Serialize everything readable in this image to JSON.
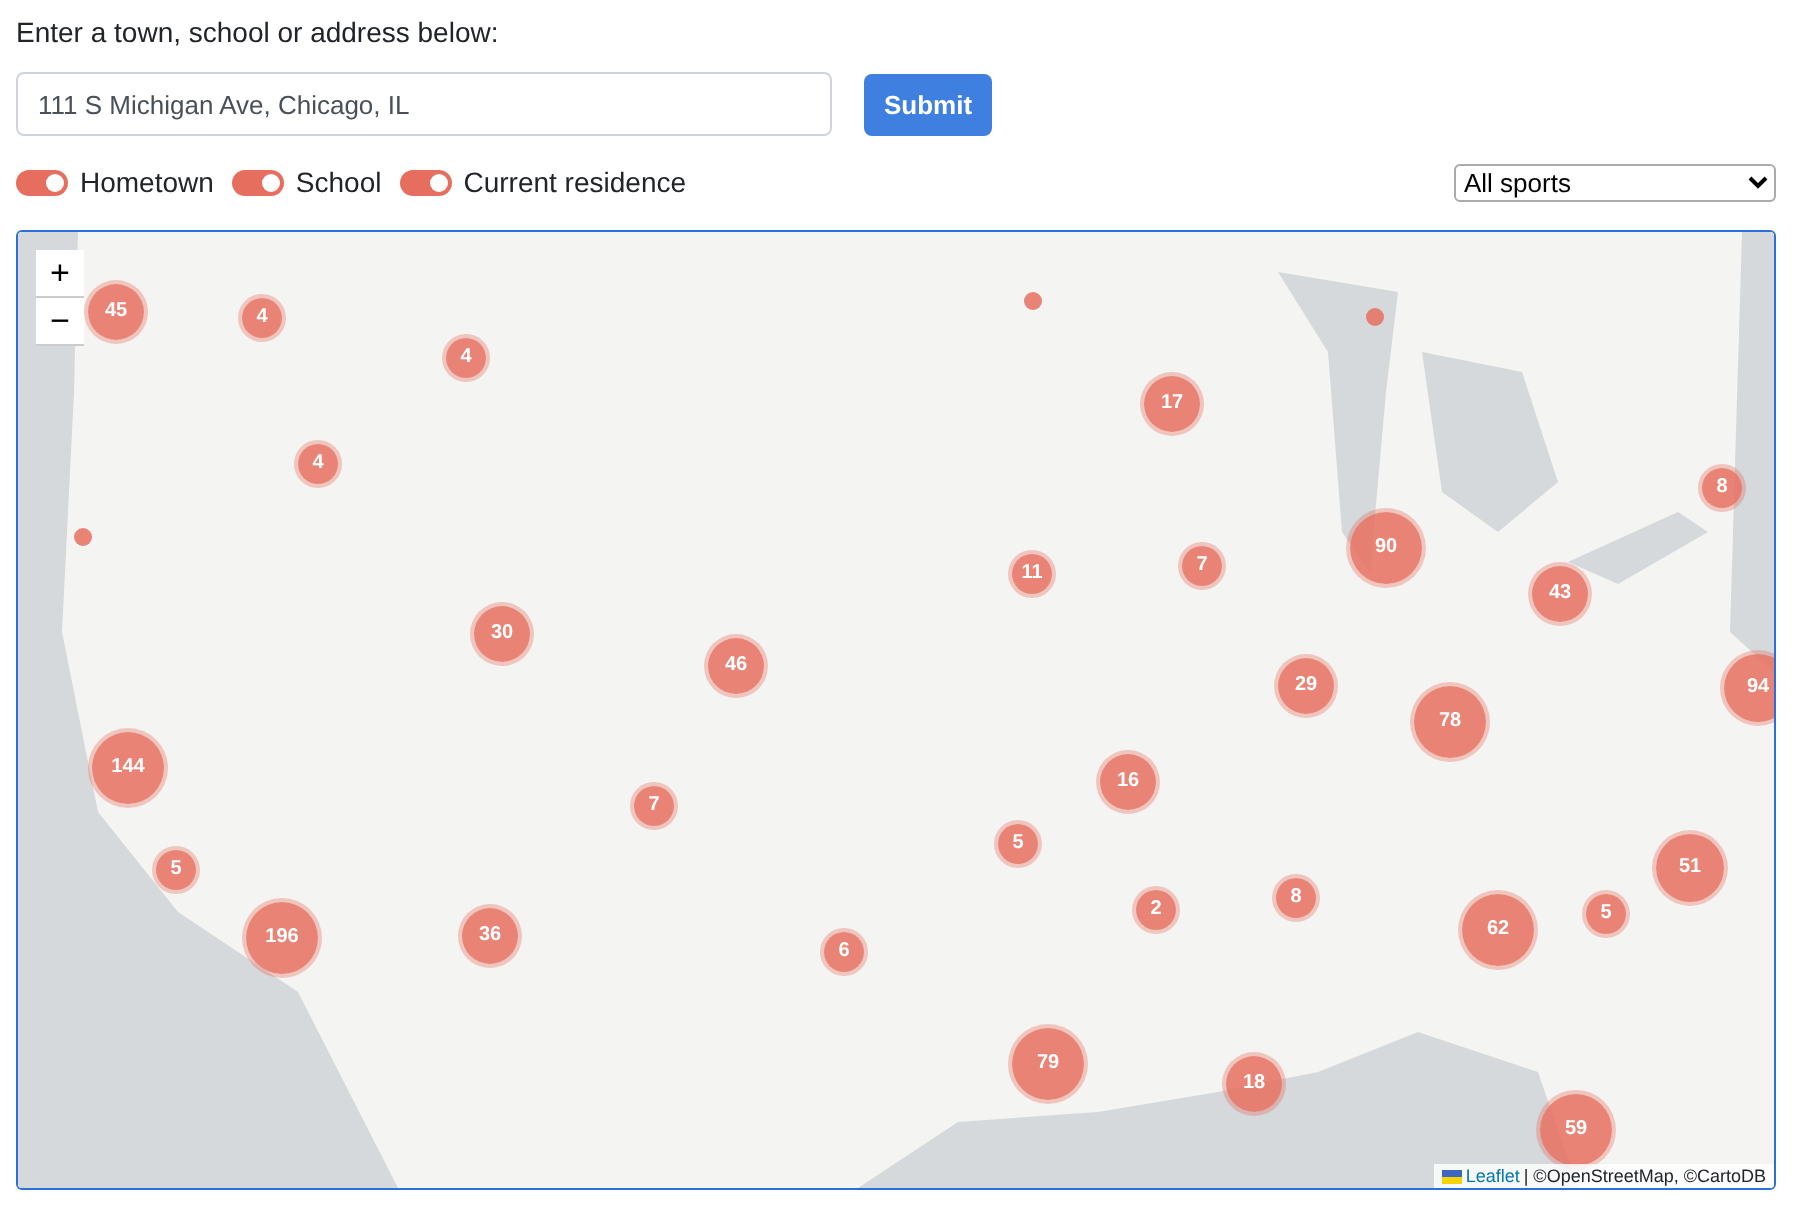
{
  "prompt": "Enter a town, school or address below:",
  "search": {
    "value": "111 S Michigan Ave, Chicago, IL"
  },
  "submit_button": "Submit",
  "filters": [
    {
      "label": "Hometown",
      "on": true
    },
    {
      "label": "School",
      "on": true
    },
    {
      "label": "Current residence",
      "on": true
    }
  ],
  "sport_select": {
    "value": "All sports"
  },
  "map": {
    "zoom_controls": [
      "+",
      "−"
    ],
    "markers": [
      {
        "kind": "cluster",
        "count": "45"
      },
      {
        "kind": "cluster",
        "count": "4"
      },
      {
        "kind": "cluster",
        "count": "4"
      },
      {
        "kind": "cluster",
        "count": "4"
      },
      {
        "kind": "dot"
      },
      {
        "kind": "dot"
      },
      {
        "kind": "dot"
      },
      {
        "kind": "cluster",
        "count": "17"
      },
      {
        "kind": "cluster",
        "count": "8"
      },
      {
        "kind": "cluster",
        "count": "90"
      },
      {
        "kind": "cluster",
        "count": "11"
      },
      {
        "kind": "cluster",
        "count": "7"
      },
      {
        "kind": "cluster",
        "count": "43"
      },
      {
        "kind": "cluster",
        "count": "30"
      },
      {
        "kind": "cluster",
        "count": "46"
      },
      {
        "kind": "cluster",
        "count": "29"
      },
      {
        "kind": "cluster",
        "count": "94"
      },
      {
        "kind": "cluster",
        "count": "78"
      },
      {
        "kind": "cluster",
        "count": "144"
      },
      {
        "kind": "cluster",
        "count": "16"
      },
      {
        "kind": "cluster",
        "count": "7"
      },
      {
        "kind": "cluster",
        "count": "5"
      },
      {
        "kind": "cluster",
        "count": "5"
      },
      {
        "kind": "cluster",
        "count": "51"
      },
      {
        "kind": "cluster",
        "count": "8"
      },
      {
        "kind": "cluster",
        "count": "2"
      },
      {
        "kind": "cluster",
        "count": "5"
      },
      {
        "kind": "cluster",
        "count": "196"
      },
      {
        "kind": "cluster",
        "count": "36"
      },
      {
        "kind": "cluster",
        "count": "62"
      },
      {
        "kind": "cluster",
        "count": "6"
      },
      {
        "kind": "cluster",
        "count": "79"
      },
      {
        "kind": "cluster",
        "count": "18"
      },
      {
        "kind": "cluster",
        "count": "59"
      }
    ],
    "attribution": {
      "link": "Leaflet",
      "text": "| ©OpenStreetMap, ©CartoDB"
    }
  }
}
